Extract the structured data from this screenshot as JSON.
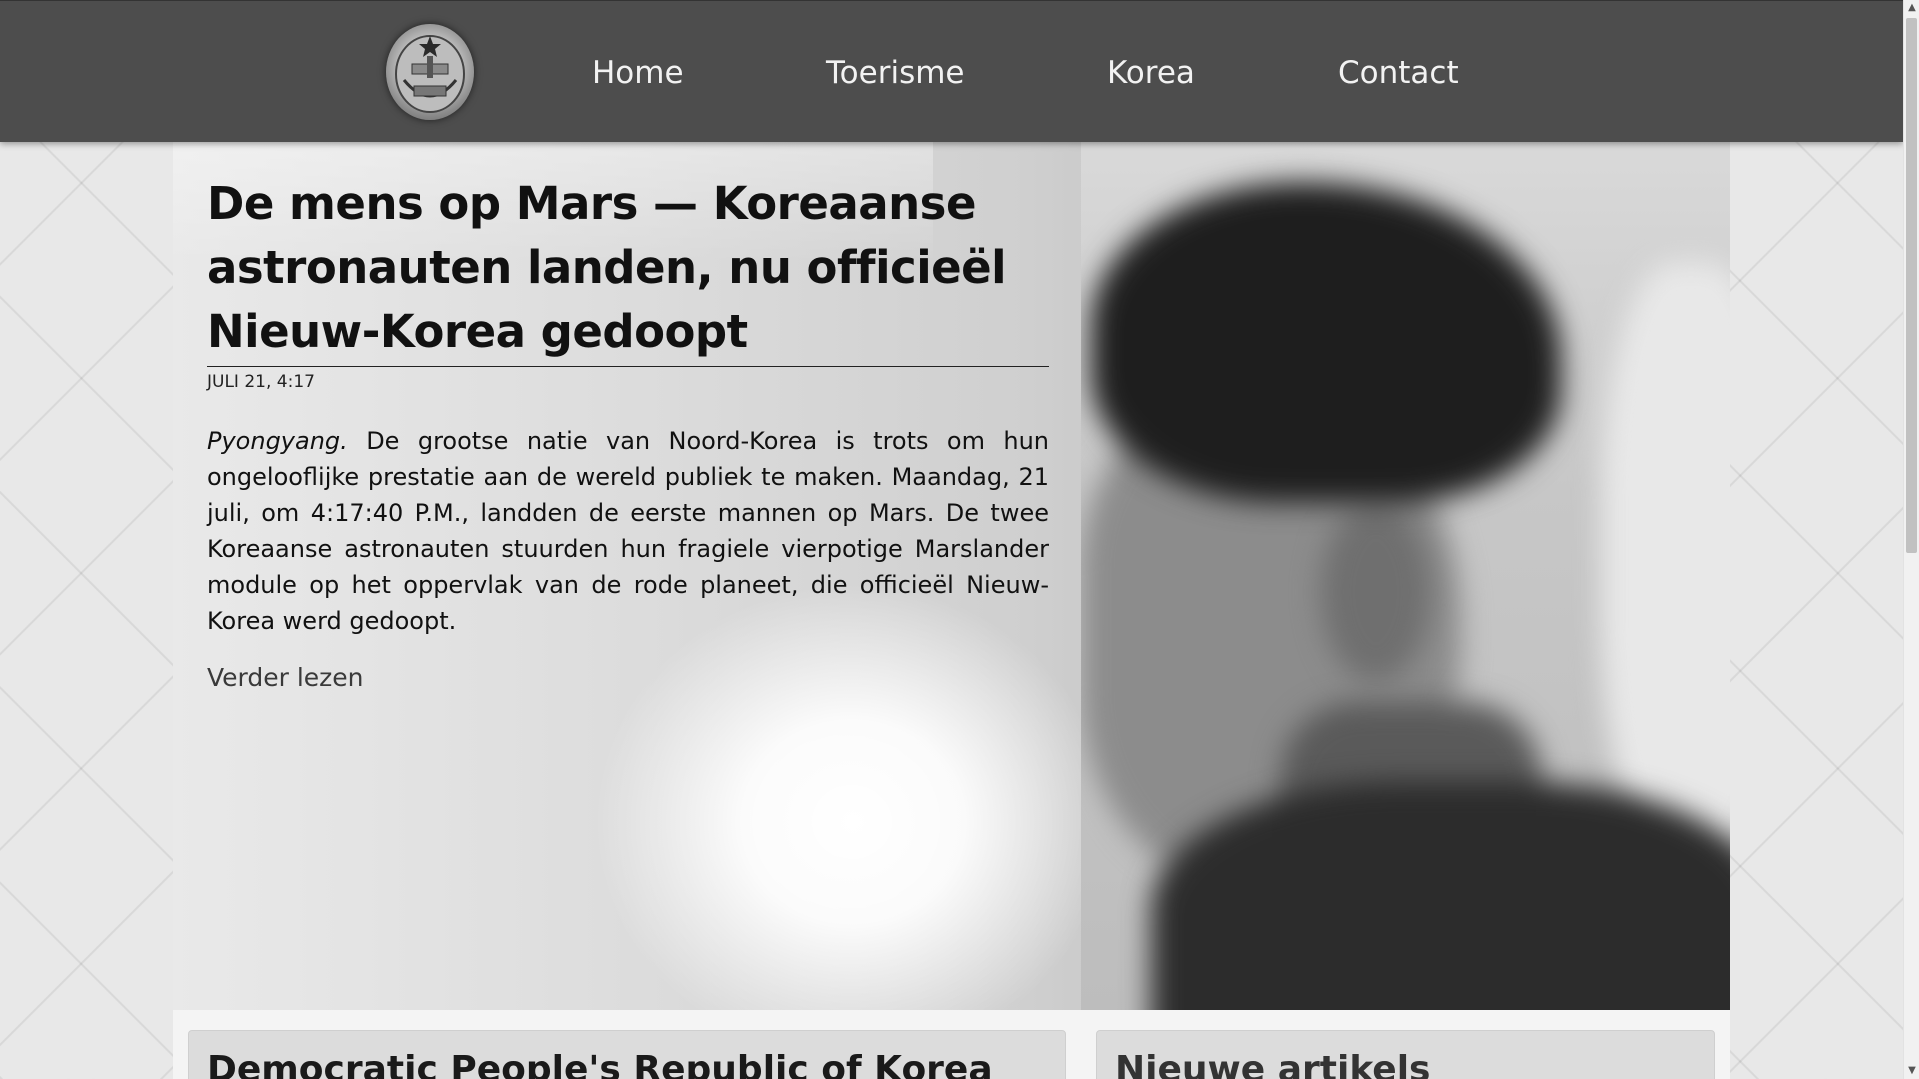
{
  "nav": {
    "logo_alt": "emblem",
    "items": [
      {
        "label": "Home"
      },
      {
        "label": "Toerisme"
      },
      {
        "label": "Korea"
      },
      {
        "label": "Contact"
      }
    ]
  },
  "article": {
    "title": "De mens op Mars — Koreaanse astronauten landen, nu officieël Nieuw-Korea gedoopt",
    "date": "JULI 21, 4:17",
    "place": "Pyongyang.",
    "body": " De grootse natie van Noord-Korea is trots om hun ongelooflijke prestatie aan de wereld publiek te maken. Maandag, 21 juli, om 4:17:40 P.M., landden de eerste mannen op Mars. De twee Koreaanse astronauten stuurden hun fragiele vierpotige Marslander module op het oppervlak van de rode planeet, die officieël Nieuw-Korea werd gedoopt.",
    "read_more": "Verder lezen"
  },
  "cards": {
    "left_title": "Democratic People's Republic of Korea",
    "right_title": "Nieuwe artikels"
  },
  "colors": {
    "navbar": "#4d4d4d",
    "nav_text": "#f2f2f2",
    "page_bg": "#e8e8e8"
  }
}
